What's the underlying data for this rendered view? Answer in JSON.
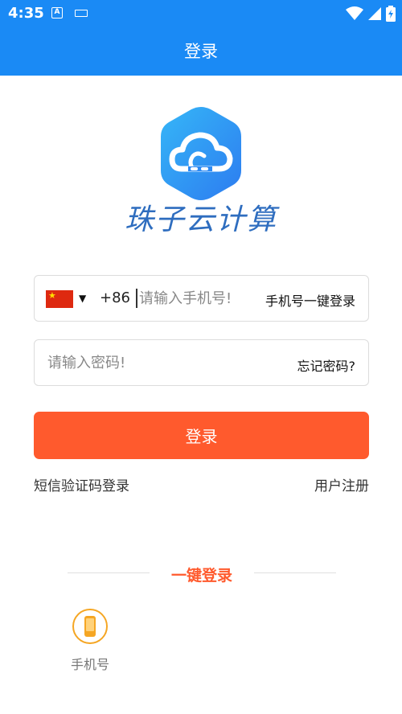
{
  "status_bar": {
    "time": "4:35",
    "a_icon_label": "A"
  },
  "header": {
    "title": "登录"
  },
  "brand": {
    "name": "珠子云计算"
  },
  "phone_field": {
    "country_flag": "china-flag",
    "country_code": "+86",
    "placeholder": "请输入手机号!",
    "one_key_login_link": "手机号一键登录"
  },
  "password_field": {
    "placeholder": "请输入密码!",
    "forgot_link": "忘记密码?"
  },
  "login_button": {
    "label": "登录"
  },
  "links": {
    "sms_login": "短信验证码登录",
    "register": "用户注册"
  },
  "one_key_section": {
    "title": "一键登录",
    "options": [
      {
        "icon": "mobile-phone-icon",
        "label": "手机号"
      }
    ]
  },
  "colors": {
    "primary": "#1a8af5",
    "accent": "#ff5a2d",
    "option_icon": "#f5a623"
  }
}
